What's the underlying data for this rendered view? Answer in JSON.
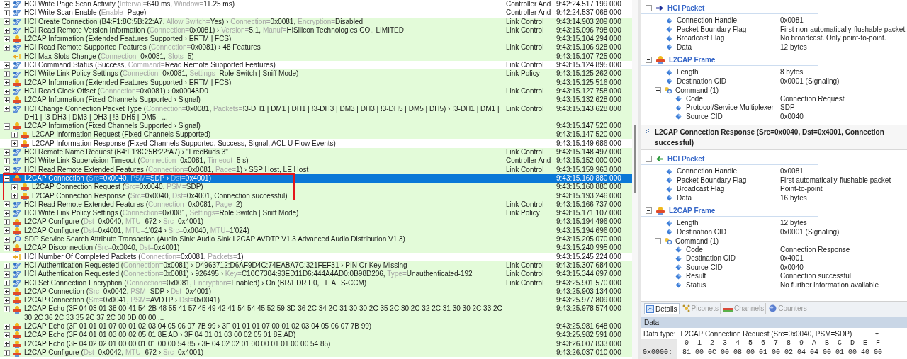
{
  "packet_list": {
    "rows": [
      {
        "kind": "hci",
        "shaded": false,
        "expandable": true,
        "expanded": false,
        "selected": false,
        "parts": [
          "HCI Write Page Scan Activity (",
          {
            "label": "Interval="
          },
          "640 ms, ",
          {
            "label": "Window="
          },
          "11.25 ms)"
        ],
        "layer": "Controller And",
        "time": "9:42:24.517 199 000"
      },
      {
        "kind": "hci",
        "shaded": false,
        "expandable": true,
        "expanded": false,
        "selected": false,
        "parts": [
          "HCI Write Scan Enable (",
          {
            "label": "Enable="
          },
          "Page)"
        ],
        "layer": "Controller And",
        "time": "9:42:24.537 068 000"
      },
      {
        "kind": "hci",
        "shaded": true,
        "expandable": true,
        "expanded": false,
        "selected": false,
        "parts": [
          "HCI Create Connection (B4:F1:8C:5B:22:A7, ",
          {
            "label": "Allow Switch="
          },
          "Yes) › ",
          {
            "label": "Connection="
          },
          "0x0081, ",
          {
            "label": "Encryption="
          },
          "Disabled"
        ],
        "layer": "Link Control",
        "time": "9:43:14.903 209 000"
      },
      {
        "kind": "hci",
        "shaded": true,
        "expandable": true,
        "expanded": false,
        "selected": false,
        "parts": [
          "HCI Read Remote Version Information (",
          {
            "label": "Connection="
          },
          "0x0081) › ",
          {
            "label": "Version="
          },
          "5.1, ",
          {
            "label": "Manuf="
          },
          "HiSilicon Technologies CO., LIMITED"
        ],
        "layer": "Link Control",
        "time": "9:43:15.096 798 000"
      },
      {
        "kind": "l2cap",
        "shaded": true,
        "expandable": true,
        "expanded": false,
        "selected": false,
        "parts": [
          "L2CAP Information (Extended Features Supported › ERTM | FCS)"
        ],
        "time": "9:43:15.104 294 000"
      },
      {
        "kind": "hci",
        "shaded": true,
        "expandable": true,
        "expanded": false,
        "selected": false,
        "parts": [
          "HCI Read Remote Supported Features (",
          {
            "label": "Connection="
          },
          "0x0081) › 48 Features"
        ],
        "layer": "Link Control",
        "time": "9:43:15.106 928 000"
      },
      {
        "kind": "event",
        "shaded": true,
        "expandable": false,
        "expanded": false,
        "selected": false,
        "parts": [
          "HCI Max Slots Change (",
          {
            "label": "Connection="
          },
          "0x0081, ",
          {
            "label": "Slots="
          },
          "5)"
        ],
        "time": "9:43:15.107 725 000"
      },
      {
        "kind": "hci",
        "shaded": false,
        "expandable": true,
        "expanded": false,
        "selected": false,
        "parts": [
          "HCI Command Status (Success, ",
          {
            "label": "Command="
          },
          "Read Remote Supported Features)"
        ],
        "layer": "Link Control",
        "time": "9:43:15.124 895 000"
      },
      {
        "kind": "hci",
        "shaded": true,
        "expandable": true,
        "expanded": false,
        "selected": false,
        "parts": [
          "HCI Write Link Policy Settings (",
          {
            "label": "Connection="
          },
          "0x0081, ",
          {
            "label": "Settings="
          },
          "Role Switch | Sniff Mode)"
        ],
        "layer": "Link Policy",
        "time": "9:43:15.125 262 000"
      },
      {
        "kind": "l2cap",
        "shaded": true,
        "expandable": true,
        "expanded": false,
        "selected": false,
        "parts": [
          "L2CAP Information (Extended Features Supported › ERTM | FCS)"
        ],
        "time": "9:43:15.125 516 000"
      },
      {
        "kind": "hci",
        "shaded": true,
        "expandable": true,
        "expanded": false,
        "selected": false,
        "parts": [
          "HCI Read Clock Offset (",
          {
            "label": "Connection="
          },
          "0x0081) › 0x00043D0"
        ],
        "layer": "Link Control",
        "time": "9:43:15.127 758 000"
      },
      {
        "kind": "l2cap",
        "shaded": true,
        "expandable": true,
        "expanded": false,
        "selected": false,
        "parts": [
          "L2CAP Information (Fixed Channels Supported › Signal)"
        ],
        "time": "9:43:15.132 628 000"
      },
      {
        "kind": "hci",
        "shaded": true,
        "expandable": true,
        "expanded": false,
        "selected": false,
        "parts": [
          "HCI Change Connection Packet Type (",
          {
            "label": "Connection="
          },
          "0x0081, ",
          {
            "label": "Packets="
          },
          "!3-DH1 | DM1 | DH1 | !3-DH3 | DM3 | DH3 | !3-DH5 | DM5 | DH5) › !3-DH1 | DM1 | DH1 | !3-DH3 | DM3 | DH3 | !3-DH5 | DM5 | ..."
        ],
        "layer": "Link Control",
        "time": "9:43:15.143 628 000"
      },
      {
        "kind": "l2cap",
        "shaded": true,
        "expandable": true,
        "expanded": true,
        "selected": false,
        "parts": [
          "L2CAP Information (Fixed Channels Supported › Signal)"
        ],
        "time": "9:43:15.147 520 000",
        "children": [
          {
            "kind": "l2cap",
            "shaded": true,
            "expandable": true,
            "expanded": false,
            "selected": false,
            "parts": [
              "L2CAP Information Request (Fixed Channels Supported)"
            ],
            "time": "9:43:15.147 520 000"
          },
          {
            "kind": "l2cap",
            "shaded": false,
            "expandable": true,
            "expanded": false,
            "selected": false,
            "parts": [
              "L2CAP Information Response (Fixed Channels Supported, Success, Signal, ACL-U Flow Events)"
            ],
            "time": "9:43:15.149 686 000"
          }
        ]
      },
      {
        "kind": "hci",
        "shaded": true,
        "expandable": true,
        "expanded": false,
        "selected": false,
        "parts": [
          "HCI Remote Name Request (B4:F1:8C:5B:22:A7) › \"FreeBuds 3\""
        ],
        "layer": "Link Control",
        "time": "9:43:15.148 497 000"
      },
      {
        "kind": "hci",
        "shaded": true,
        "expandable": true,
        "expanded": false,
        "selected": false,
        "parts": [
          "HCI Write Link Supervision Timeout (",
          {
            "label": "Connection="
          },
          "0x0081, ",
          {
            "label": "Timeout="
          },
          "5 s)"
        ],
        "layer": "Controller And",
        "time": "9:43:15.152 000 000"
      },
      {
        "kind": "hci",
        "shaded": true,
        "expandable": true,
        "expanded": false,
        "selected": false,
        "parts": [
          "HCI Read Remote Extended Features (",
          {
            "label": "Connection="
          },
          "0x0081, ",
          {
            "label": "Page="
          },
          "1) › SSP Host, LE Host"
        ],
        "layer": "Link Control",
        "time": "9:43:15.159 963 000"
      },
      {
        "kind": "l2cap",
        "expandable": true,
        "expanded": true,
        "selected": true,
        "outlined": true,
        "parts": [
          "L2CAP Connection (",
          {
            "label": "Src="
          },
          "0x0040, ",
          {
            "label": "PSM="
          },
          "SDP › ",
          {
            "label": "Dst="
          },
          "0x4001)"
        ],
        "time": "9:43:15.160 880 000",
        "children": [
          {
            "kind": "l2cap",
            "shaded": true,
            "expandable": true,
            "expanded": false,
            "selected": false,
            "parts": [
              "L2CAP Connection Request (",
              {
                "label": "Src="
              },
              "0x0040, ",
              {
                "label": "PSM="
              },
              "SDP)"
            ],
            "time": "9:43:15.160 880 000"
          },
          {
            "kind": "l2cap",
            "shaded": true,
            "expandable": true,
            "expanded": false,
            "selected": false,
            "parts": [
              "L2CAP Connection Response (",
              {
                "label": "Src="
              },
              "0x0040, ",
              {
                "label": "Dst="
              },
              "0x4001, Connection successful)"
            ],
            "time": "9:43:15.193 246 000"
          }
        ]
      },
      {
        "kind": "hci",
        "shaded": true,
        "expandable": true,
        "expanded": false,
        "selected": false,
        "parts": [
          "HCI Read Remote Extended Features (",
          {
            "label": "Connection="
          },
          "0x0081, ",
          {
            "label": "Page="
          },
          "2)"
        ],
        "layer": "Link Control",
        "time": "9:43:15.166 737 000"
      },
      {
        "kind": "hci",
        "shaded": true,
        "expandable": true,
        "expanded": false,
        "selected": false,
        "parts": [
          "HCI Write Link Policy Settings (",
          {
            "label": "Connection="
          },
          "0x0081, ",
          {
            "label": "Settings="
          },
          "Role Switch | Sniff Mode)"
        ],
        "layer": "Link Policy",
        "time": "9:43:15.171 107 000"
      },
      {
        "kind": "l2cap",
        "shaded": true,
        "expandable": true,
        "expanded": false,
        "selected": false,
        "parts": [
          "L2CAP Configure (",
          {
            "label": "Dst="
          },
          "0x0040, ",
          {
            "label": "MTU="
          },
          "672 › ",
          {
            "label": "Src="
          },
          "0x4001)"
        ],
        "time": "9:43:15.194 496 000"
      },
      {
        "kind": "l2cap",
        "shaded": true,
        "expandable": true,
        "expanded": false,
        "selected": false,
        "parts": [
          "L2CAP Configure (",
          {
            "label": "Dst="
          },
          "0x4001, ",
          {
            "label": "MTU="
          },
          "1'024 › ",
          {
            "label": "Src="
          },
          "0x0040, ",
          {
            "label": "MTU="
          },
          "1'024)"
        ],
        "time": "9:43:15.194 696 000"
      },
      {
        "kind": "sdp",
        "shaded": true,
        "expandable": true,
        "expanded": false,
        "selected": false,
        "parts": [
          "SDP Service Search Attribute Transaction (Audio Sink: Audio Sink L2CAP AVDTP V1.3 Advanced Audio Distribution V1.3)"
        ],
        "time": "9:43:15.205 070 000"
      },
      {
        "kind": "l2cap",
        "shaded": true,
        "expandable": true,
        "expanded": false,
        "selected": false,
        "parts": [
          "L2CAP Disconnection (",
          {
            "label": "Src="
          },
          "0x0040, ",
          {
            "label": "Dst="
          },
          "0x4001)"
        ],
        "time": "9:43:15.240 995 000"
      },
      {
        "kind": "event",
        "shaded": false,
        "expandable": false,
        "expanded": false,
        "selected": false,
        "parts": [
          "HCI Number Of Completed Packets (",
          {
            "label": "Connection="
          },
          "0x0081, ",
          {
            "label": "Packets="
          },
          "1)"
        ],
        "time": "9:43:15.245 224 000"
      },
      {
        "kind": "hci",
        "shaded": true,
        "expandable": true,
        "expanded": false,
        "selected": false,
        "parts": [
          "HCI Authentication Requested (",
          {
            "label": "Connection="
          },
          "0x0081) › D4963712:D6AF9D4C:74EABA7C:321FEF31 › PIN Or Key Missing"
        ],
        "layer": "Link Control",
        "time": "9:43:15.307 684 000"
      },
      {
        "kind": "hci",
        "shaded": true,
        "expandable": true,
        "expanded": false,
        "selected": false,
        "parts": [
          "HCI Authentication Requested (",
          {
            "label": "Connection="
          },
          "0x0081) › 926495 › ",
          {
            "label": "Key="
          },
          "C10C7304:93ED11D6:444A4AD0:0B98D206, ",
          {
            "label": "Type="
          },
          "Unauthenticated-192"
        ],
        "layer": "Link Control",
        "time": "9:43:15.344 697 000"
      },
      {
        "kind": "hci",
        "shaded": true,
        "expandable": true,
        "expanded": false,
        "selected": false,
        "parts": [
          "HCI Set Connection Encryption (",
          {
            "label": "Connection="
          },
          "0x0081, ",
          {
            "label": "Encryption="
          },
          "Enabled) › On (BR/EDR E0, LE AES-CCM)"
        ],
        "layer": "Link Control",
        "time": "9:43:25.901 570 000"
      },
      {
        "kind": "l2cap",
        "shaded": true,
        "expandable": true,
        "expanded": false,
        "selected": false,
        "parts": [
          "L2CAP Connection (",
          {
            "label": "Src="
          },
          "0x0042, ",
          {
            "label": "PSM="
          },
          "SDP › ",
          {
            "label": "Dst="
          },
          "0x4001)"
        ],
        "time": "9:43:25.903 134 000"
      },
      {
        "kind": "l2cap",
        "shaded": true,
        "expandable": true,
        "expanded": false,
        "selected": false,
        "parts": [
          "L2CAP Connection (",
          {
            "label": "Src="
          },
          "0x0041, ",
          {
            "label": "PSM="
          },
          "AVDTP › ",
          {
            "label": "Dst="
          },
          "0x0041)"
        ],
        "time": "9:43:25.977 809 000"
      },
      {
        "kind": "l2cap",
        "shaded": true,
        "expandable": true,
        "expanded": false,
        "selected": false,
        "parts": [
          "L2CAP Echo (3F 04 03 01 38 00 41 54 2B 48 55 41 57 45 49 42 41 54 54 45 52 59 3D 36 2C 34 2C 31 30 30 2C 35 2C 30 2C 32 2C 31 30 30 2C 33 2C 30 2C 36 2C 33 35 2C 37 2C 30 0D 00 00 ..."
        ],
        "time": "9:43:25.978 574 000"
      },
      {
        "kind": "l2cap",
        "shaded": true,
        "expandable": true,
        "expanded": false,
        "selected": false,
        "parts": [
          "L2CAP Echo (3F 01 01 01 07 00 01 02 03 04 05 06 07 7B 99 › 3F 01 01 01 07 00 01 02 03 04 05 06 07 7B 99)"
        ],
        "time": "9:43:25.981 648 000"
      },
      {
        "kind": "l2cap",
        "shaded": true,
        "expandable": true,
        "expanded": false,
        "selected": false,
        "parts": [
          "L2CAP Echo (3F 04 01 01 03 00 02 05 01 8E AD › 3F 04 01 01 03 00 02 05 01 8E AD)"
        ],
        "time": "9:43:25.982 591 000"
      },
      {
        "kind": "l2cap",
        "shaded": true,
        "expandable": true,
        "expanded": false,
        "selected": false,
        "parts": [
          "L2CAP Echo (3F 04 02 02 01 00 00 01 01 00 00 54 85 › 3F 04 02 02 01 00 00 01 01 00 00 54 85)"
        ],
        "time": "9:43:26.007 833 000"
      },
      {
        "kind": "l2cap",
        "shaded": true,
        "expandable": true,
        "expanded": false,
        "selected": false,
        "parts": [
          "L2CAP Configure (",
          {
            "label": "Dst="
          },
          "0x0042, ",
          {
            "label": "MTU="
          },
          "672 › ",
          {
            "label": "Src="
          },
          "0x4001)"
        ],
        "time": "9:43:26.037 010 000"
      }
    ]
  },
  "details": {
    "packets": [
      {
        "sections": [
          {
            "kind": "sent",
            "title": "HCI Packet",
            "expanded": true,
            "fields": [
              {
                "name": "Connection Handle",
                "value": "0x0081"
              },
              {
                "name": "Packet Boundary Flag",
                "value": "First non-automatically-flushable packet"
              },
              {
                "name": "Broadcast Flag",
                "value": "No broadcast. Only point-to-point."
              },
              {
                "name": "Data",
                "value": "12 bytes"
              }
            ]
          },
          {
            "kind": "l2cap",
            "title": "L2CAP Frame",
            "expanded": true,
            "fields": [
              {
                "name": "Length",
                "value": "8 bytes"
              },
              {
                "name": "Destination CID",
                "value": "0x0001 (Signaling)"
              },
              {
                "name": "Command (1)",
                "expanded": true,
                "children": [
                  {
                    "name": "Code",
                    "value": "Connection Request"
                  },
                  {
                    "name": "Protocol/Service Multiplexer",
                    "value": "SDP"
                  },
                  {
                    "name": "Source CID",
                    "value": "0x0040"
                  }
                ]
              }
            ]
          }
        ]
      },
      {
        "title": "L2CAP Connection Response (Src=0x0040, Dst=0x4001, Connection successful)",
        "sections": [
          {
            "kind": "received",
            "title": "HCI Packet",
            "expanded": true,
            "fields": [
              {
                "name": "Connection Handle",
                "value": "0x0081"
              },
              {
                "name": "Packet Boundary Flag",
                "value": "First automatically-flushable packet"
              },
              {
                "name": "Broadcast Flag",
                "value": "Point-to-point"
              },
              {
                "name": "Data",
                "value": "16 bytes"
              }
            ]
          },
          {
            "kind": "l2cap",
            "title": "L2CAP Frame",
            "expanded": true,
            "fields": [
              {
                "name": "Length",
                "value": "12 bytes"
              },
              {
                "name": "Destination CID",
                "value": "0x0001 (Signaling)"
              },
              {
                "name": "Command (1)",
                "expanded": true,
                "children": [
                  {
                    "name": "Code",
                    "value": "Connection Response"
                  },
                  {
                    "name": "Destination CID",
                    "value": "0x4001"
                  },
                  {
                    "name": "Source CID",
                    "value": "0x0040"
                  },
                  {
                    "name": "Result",
                    "value": "Connection successful"
                  },
                  {
                    "name": "Status",
                    "value": "No further information available"
                  }
                ]
              }
            ]
          }
        ]
      }
    ]
  },
  "bottom_tabs": [
    {
      "kind": "details",
      "label": "Details",
      "selected": true
    },
    {
      "kind": "piconets",
      "label": "Piconets",
      "selected": false
    },
    {
      "kind": "channels",
      "label": "Channels",
      "selected": false
    },
    {
      "kind": "counters",
      "label": "Counters",
      "selected": false
    }
  ],
  "data_pane": {
    "title": "Data",
    "type_label": "Data type:",
    "type_value": "L2CAP Connection Request (Src=0x0040, PSM=SDP)",
    "columns": [
      "0",
      "1",
      "2",
      "3",
      "4",
      "5",
      "6",
      "7",
      "8",
      "9",
      "A",
      "B",
      "C",
      "D",
      "E",
      "F"
    ],
    "rows": [
      {
        "offset": "0x0000:",
        "bytes": [
          "81",
          "00",
          "0C",
          "00",
          "08",
          "00",
          "01",
          "00",
          "02",
          "04",
          "04",
          "00",
          "01",
          "00",
          "40",
          "00"
        ]
      }
    ]
  }
}
